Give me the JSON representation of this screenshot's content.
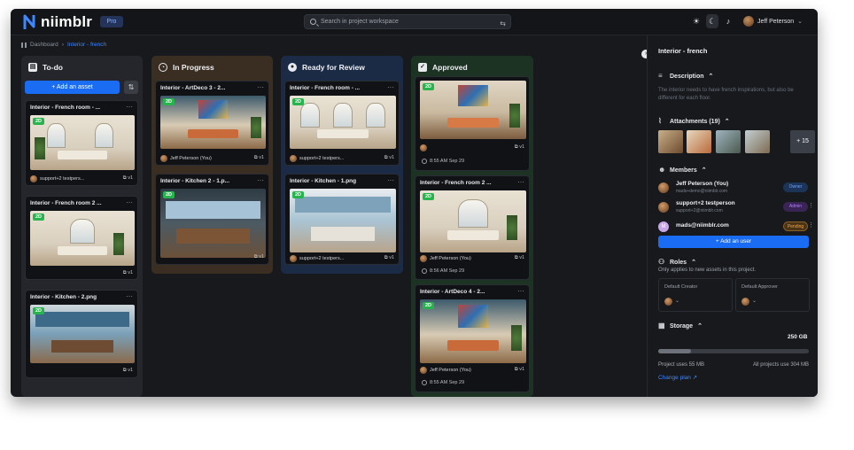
{
  "app": {
    "name": "niimblr",
    "plan_badge": "Pro"
  },
  "search": {
    "placeholder": "Search in project workspace"
  },
  "header": {
    "user_name": "Jeff Peterson"
  },
  "breadcrumb": {
    "root": "Dashboard",
    "sep": "›",
    "current": "Interior - french"
  },
  "columns": {
    "todo": {
      "title": "To-do",
      "add_label": "+ Add an asset",
      "cards": [
        {
          "title": "Interior - French room - ...",
          "badge": "2D",
          "user": "support+2 testpers...",
          "stats": "v1"
        },
        {
          "title": "Interior - French room 2 ...",
          "badge": "2D",
          "stats": "v1"
        },
        {
          "title": "Interior - Kitchen - 2.png",
          "badge": "2D",
          "stats": "v1"
        }
      ]
    },
    "progress": {
      "title": "In Progress",
      "cards": [
        {
          "title": "Interior - ArtDeco 3 - 2...",
          "badge": "2D",
          "user": "Jeff Peterson (You)",
          "stats": "v1"
        },
        {
          "title": "Interior - Kitchen 2 - 1.p...",
          "badge": "2D",
          "stats": "v1"
        }
      ]
    },
    "review": {
      "title": "Ready for Review",
      "cards": [
        {
          "title": "Interior - French room - ...",
          "badge": "2D",
          "user": "support+2 testpers...",
          "stats": "v1"
        },
        {
          "title": "Interior - Kitchen - 1.png",
          "badge": "2D",
          "user": "support+2 testpers...",
          "stats": "v1"
        }
      ]
    },
    "approved": {
      "title": "Approved",
      "cards": [
        {
          "title": "",
          "badge": "2D",
          "user": "",
          "stats": "v1",
          "time": "8:55 AM Sep 29"
        },
        {
          "title": "Interior - French room 2 ...",
          "badge": "2D",
          "user": "Jeff Peterson (You)",
          "stats": "v1",
          "time": "8:56 AM Sep 29"
        },
        {
          "title": "Interior - ArtDeco 4 - 2...",
          "badge": "2D",
          "user": "Jeff Peterson (You)",
          "stats": "v1",
          "time": "8:55 AM Sep 29"
        }
      ]
    }
  },
  "panel": {
    "title": "Interior - french",
    "description_label": "Description",
    "description_text": "The interior needs to have french inspirations, but also be different for each floor.",
    "attachments_label": "Attachments (19)",
    "attachments_more": "+ 15",
    "members_label": "Members",
    "members": [
      {
        "name": "Jeff Peterson (You)",
        "email": "mads+demo@niimblr.com",
        "role": "Owner"
      },
      {
        "name": "support+2 testperson",
        "email": "support+2@niimblr.com",
        "role": "Admin"
      },
      {
        "name": "mads@niimblr.com",
        "email": "",
        "role": "Pending",
        "initial": "M"
      }
    ],
    "add_user_label": "+ Add an user",
    "roles_label": "Roles",
    "roles_note": "Only applies to new assets in this project.",
    "default_creator": "Default Creator",
    "default_approver": "Default Approver",
    "storage_label": "Storage",
    "storage_total": "250 GB",
    "storage_fill_percent": 22,
    "project_uses": "Project uses 55 MB",
    "all_projects_use": "All projects use 304 MB",
    "change_plan": "Change plan ↗"
  }
}
